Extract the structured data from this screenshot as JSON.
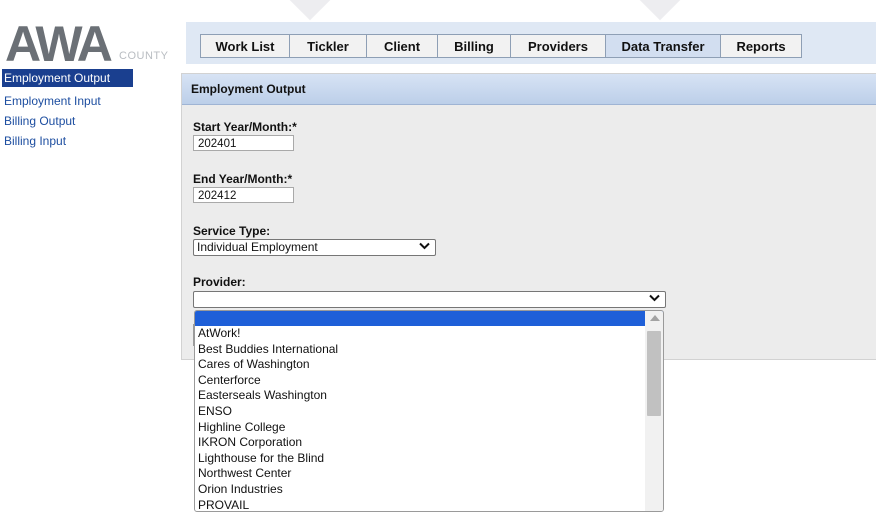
{
  "logo": {
    "main": "AWA",
    "sub": "COUNTY"
  },
  "tabs": [
    {
      "label": "Work List",
      "active": false
    },
    {
      "label": "Tickler",
      "active": false
    },
    {
      "label": "Client",
      "active": false
    },
    {
      "label": "Billing",
      "active": false
    },
    {
      "label": "Providers",
      "active": false
    },
    {
      "label": "Data Transfer",
      "active": true
    },
    {
      "label": "Reports",
      "active": false
    }
  ],
  "sidebar": {
    "items": [
      {
        "label": "Employment Output",
        "active": true
      },
      {
        "label": "Employment Input",
        "active": false
      },
      {
        "label": "Billing Output",
        "active": false
      },
      {
        "label": "Billing Input",
        "active": false
      }
    ]
  },
  "panel": {
    "title": "Employment Output",
    "start_label": "Start Year/Month:*",
    "start_value": "202401",
    "end_label": "End Year/Month:*",
    "end_value": "202412",
    "service_label": "Service Type:",
    "service_value": "Individual Employment",
    "provider_label": "Provider:",
    "provider_value": ""
  },
  "provider_options": [
    "AtWork!",
    "Best Buddies International",
    "Cares of Washington",
    "Centerforce",
    "Easterseals Washington",
    "ENSO",
    "Highline College",
    "IKRON Corporation",
    "Lighthouse for the Blind",
    "Northwest Center",
    "Orion Industries",
    "PROVAIL"
  ],
  "colors": {
    "tabbar_bg": "#dfe8f4",
    "active_tab": "#d2def0",
    "sidebar_active": "#1a3f8f",
    "link": "#1d4ea0",
    "dropdown_highlight": "#1e5fd8"
  },
  "icons": {
    "select_chevron": "chevron-down-icon",
    "scroll_up": "scroll-up-arrow-icon"
  }
}
